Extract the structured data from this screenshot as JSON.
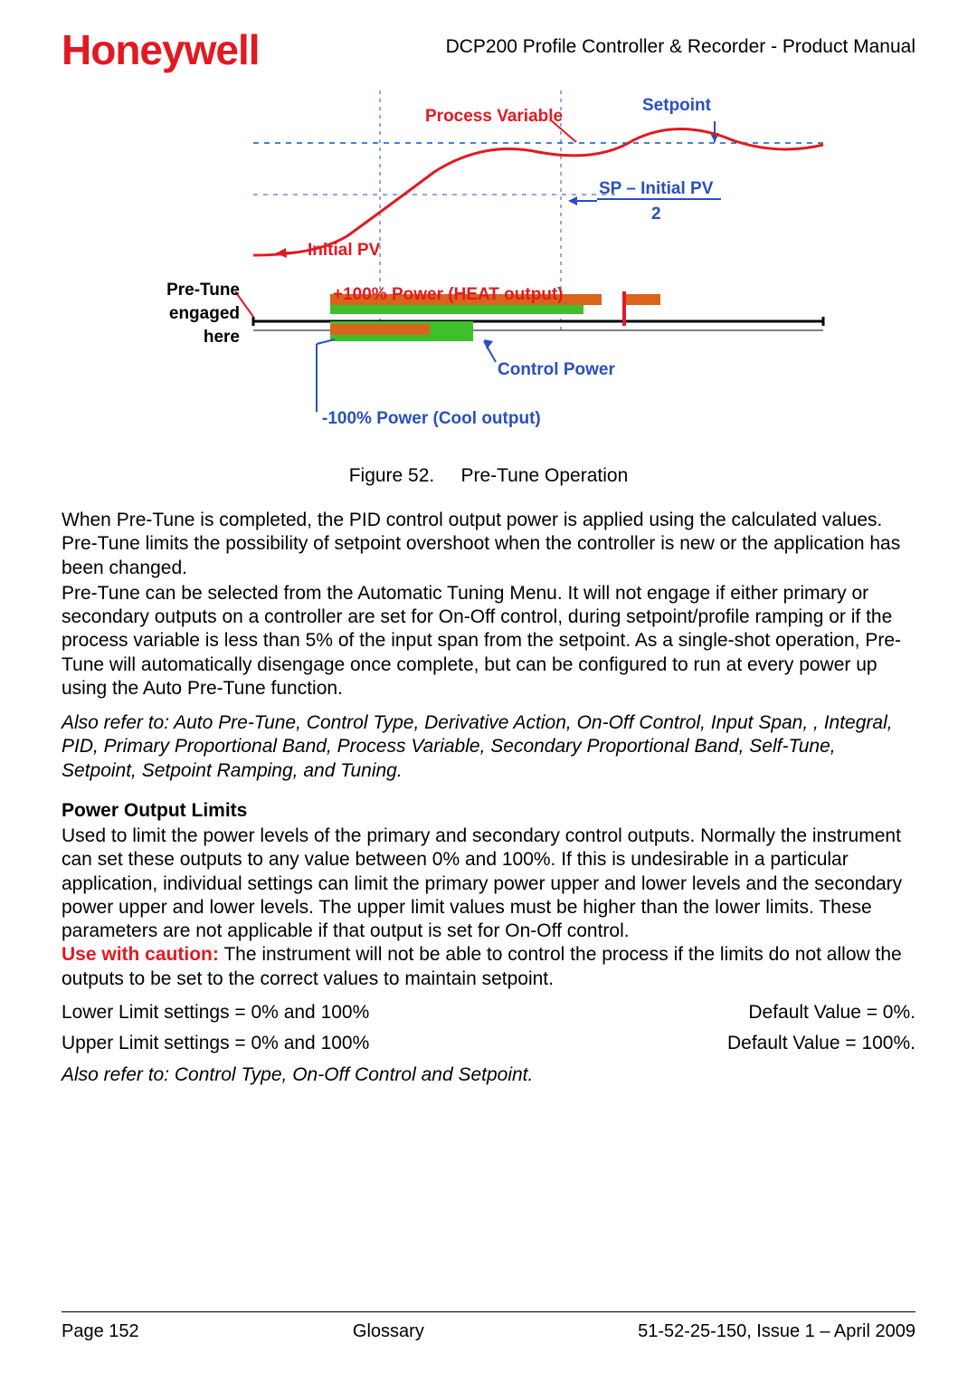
{
  "header": {
    "brand": "Honeywell",
    "doc_title": "DCP200 Profile Controller & Recorder - Product Manual"
  },
  "figure": {
    "setpoint": "Setpoint",
    "process_variable": "Process Variable",
    "sp_initial_pv_line1": "SP – Initial PV",
    "sp_initial_pv_line2": "2",
    "initial_pv": "Initial PV",
    "pretune_engaged_l1": "Pre-Tune",
    "pretune_engaged_l2": "engaged",
    "pretune_engaged_l3": "here",
    "heat_power": "+100% Power (HEAT output)",
    "control_power": "Control Power",
    "cool_power": "-100% Power (Cool output)"
  },
  "caption_prefix": "Figure 52.",
  "caption_text": "Pre-Tune Operation",
  "para1": "When Pre-Tune is completed, the PID control output power is applied using the calculated values. Pre-Tune limits the possibility of setpoint overshoot when the controller is new or the application has been changed.",
  "para2": "Pre-Tune can be selected from the Automatic Tuning Menu. It will not engage if either primary or secondary outputs on a controller are set for On-Off control, during setpoint/profile ramping or if the process variable is less than 5% of the input span from the setpoint. As a single-shot operation, Pre-Tune will automatically disengage once complete, but can be configured to run at every power up using the Auto Pre-Tune function.",
  "para3_italic": "Also refer to: Auto Pre-Tune, Control Type, Derivative Action, On-Off Control, Input Span, , Integral, PID, Primary Proportional Band, Process Variable, Secondary Proportional Band, Self-Tune, Setpoint, Setpoint Ramping, and Tuning.",
  "pol_heading": "Power Output Limits",
  "pol_body_main": "Used to limit the power levels of the primary and secondary control outputs. Normally the instrument can set these outputs to any value between 0% and 100%. If this is undesirable in a particular application, individual settings can limit the primary power upper and lower levels and the secondary power upper and lower levels. The upper limit values must be higher than the lower limits. These parameters are not applicable if that output is set for On-Off control.",
  "pol_caution_label": "Use with caution:",
  "pol_caution_rest": " The instrument will not be able to control the process if the limits do not allow the outputs to be set to the correct values to maintain setpoint.",
  "lower_limit_left": "Lower Limit settings = 0% and 100%",
  "lower_limit_right": "Default Value = 0%.",
  "upper_limit_left": "Upper Limit settings = 0% and 100%",
  "upper_limit_right": "Default Value = 100%.",
  "also_refer_2": "Also refer to: Control Type, On-Off Control and Setpoint.",
  "footer": {
    "page": "Page 152",
    "section": "Glossary",
    "docnum": "51-52-25-150, Issue 1 – April 2009"
  }
}
